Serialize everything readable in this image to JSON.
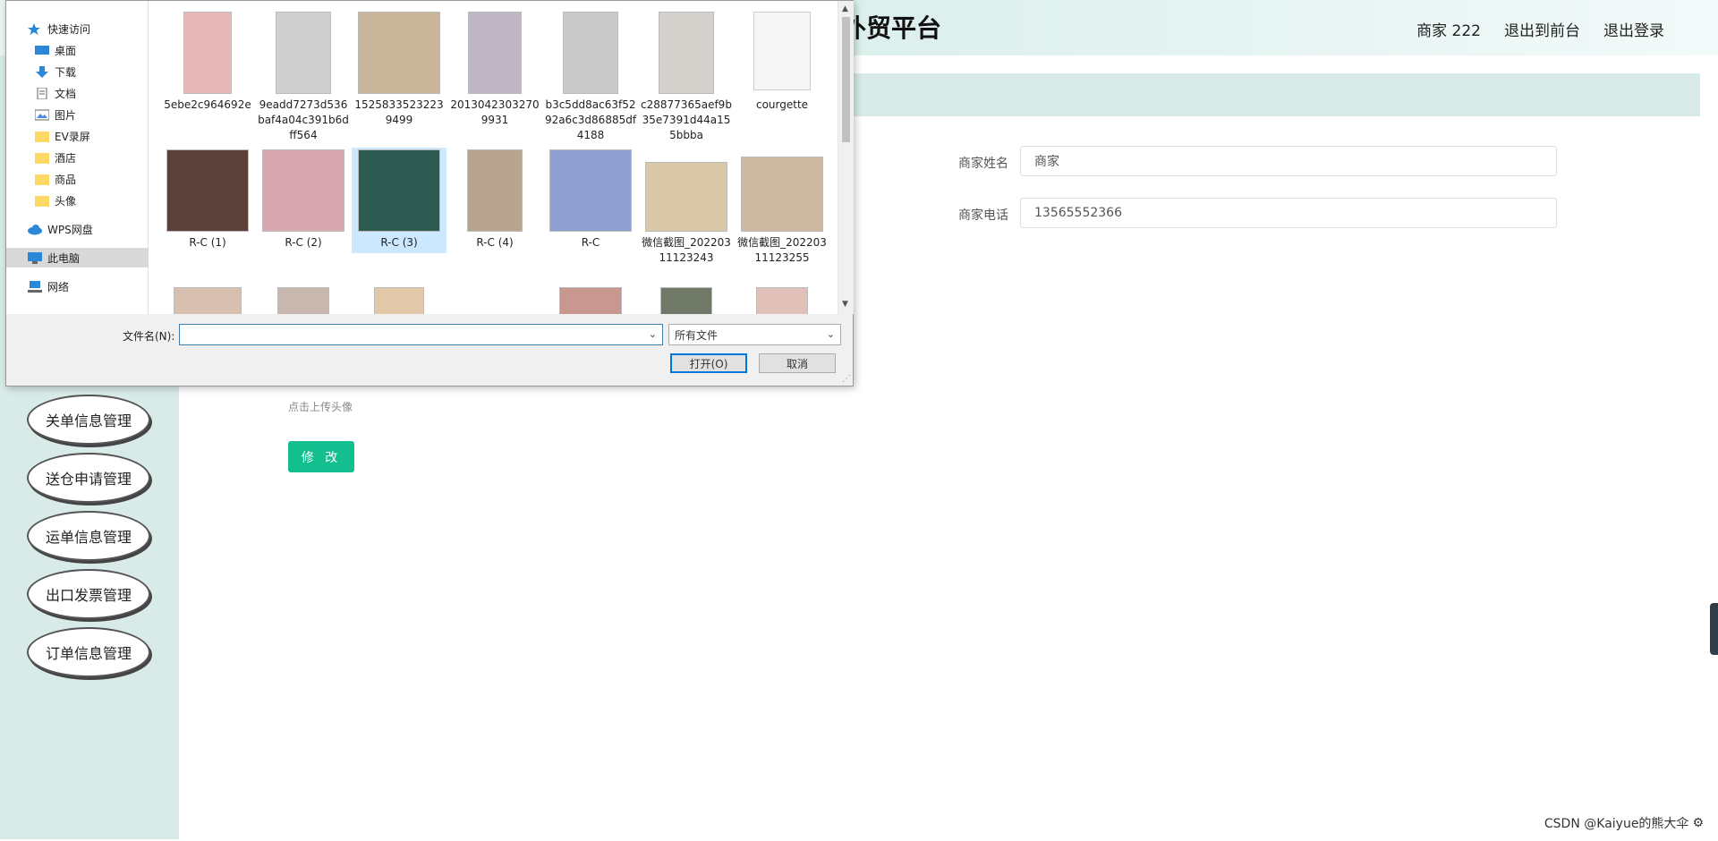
{
  "site": {
    "title": "外贸平台",
    "user": "商家 222",
    "nav": [
      "退出到前台",
      "退出登录"
    ]
  },
  "sidebar": {
    "items": [
      {
        "label": "关单信息管理"
      },
      {
        "label": "送仓申请管理"
      },
      {
        "label": "运单信息管理"
      },
      {
        "label": "出口发票管理"
      },
      {
        "label": "订单信息管理"
      }
    ]
  },
  "form": {
    "name_label": "商家姓名",
    "name_value": "商家",
    "phone_label": "商家电话",
    "phone_value": "13565552366",
    "upload_hint": "点击上传头像",
    "submit_label": "修 改"
  },
  "watermark": "CSDN @Kaiyue的熊大伞",
  "dialog": {
    "nav": [
      {
        "label": "快速访问",
        "icon": "star-icon",
        "pinned": false
      },
      {
        "label": "桌面",
        "icon": "desktop-icon",
        "pinned": true
      },
      {
        "label": "下载",
        "icon": "download-icon",
        "pinned": true
      },
      {
        "label": "文档",
        "icon": "document-icon",
        "pinned": true
      },
      {
        "label": "图片",
        "icon": "pictures-icon",
        "pinned": true
      },
      {
        "label": "EV录屏",
        "icon": "folder-icon",
        "pinned": false
      },
      {
        "label": "酒店",
        "icon": "folder-icon",
        "pinned": false
      },
      {
        "label": "商品",
        "icon": "folder-icon",
        "pinned": false
      },
      {
        "label": "头像",
        "icon": "folder-icon",
        "pinned": false
      },
      {
        "label": "WPS网盘",
        "icon": "cloud-icon",
        "pinned": false
      },
      {
        "label": "此电脑",
        "icon": "computer-icon",
        "pinned": false
      },
      {
        "label": "网络",
        "icon": "network-icon",
        "pinned": false
      }
    ],
    "files": [
      {
        "name": "5ebe2c964692e",
        "color": "#e8b7b8"
      },
      {
        "name": "9eadd7273d536baf4a04c391b6dff564",
        "color": "#cfcfcf"
      },
      {
        "name": "15258335232239499",
        "color": "#c8b59a"
      },
      {
        "name": "20130423032709931",
        "color": "#bfb8c4"
      },
      {
        "name": "b3c5dd8ac63f5292a6c3d86885df4188",
        "color": "#c9c9c9"
      },
      {
        "name": "c28877365aef9b35e7391d44a155bbba",
        "color": "#d4d0cc"
      },
      {
        "name": "courgette",
        "color": "#f6f6f6"
      },
      {
        "name": "R-C (1)",
        "color": "#5a4038"
      },
      {
        "name": "R-C (2)",
        "color": "#d8a8b0"
      },
      {
        "name": "R-C (3)",
        "color": "#2d5b52"
      },
      {
        "name": "R-C (4)",
        "color": "#b8a590"
      },
      {
        "name": "R-C",
        "color": "#8fa0d0"
      },
      {
        "name": "微信截图_20220311123243",
        "color": "#d8c8a8"
      },
      {
        "name": "微信截图_20220311123255",
        "color": "#cdb9a2"
      },
      {
        "name": "",
        "color": "#d8c0b0"
      },
      {
        "name": "",
        "color": "#c8b8b0"
      },
      {
        "name": "",
        "color": "#e0c8a8"
      },
      {
        "name": "",
        "color": "#c89890"
      },
      {
        "name": "",
        "color": "#707868"
      },
      {
        "name": "",
        "color": "#e0c0b8"
      }
    ],
    "filename_label": "文件名(N):",
    "filename_value": "",
    "filetype": "所有文件",
    "open_label": "打开(O)",
    "cancel_label": "取消"
  }
}
